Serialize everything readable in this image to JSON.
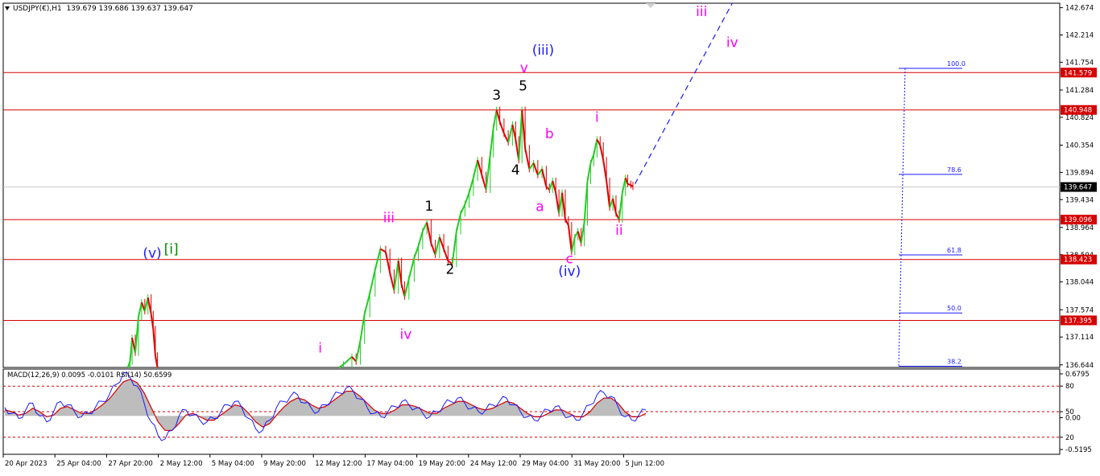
{
  "header": {
    "symbol": "USDJPY(€),H1",
    "ohlc": "139.679 139.686 139.637 139.647"
  },
  "indicator_header": "MACD(12,26,9) 0.0095 -0.0101  RSI(14) 50.6599",
  "colors": {
    "level_line": "#d50000",
    "wave_magenta": "#ff00ff",
    "wave_blue": "#1a1aff",
    "wave_green": "#008800",
    "bull_candle": "#22cc22",
    "bear_candle": "#e00000",
    "fib_blue": "#1a1aff",
    "current_price_bg": "#000000"
  },
  "chart_data": [
    {
      "type": "line",
      "name": "price",
      "ylim": [
        136.6,
        142.75
      ],
      "y_ticks": [
        "142.674",
        "142.214",
        "141.754",
        "141.284",
        "140.824",
        "140.354",
        "139.894",
        "139.434",
        "138.964",
        "138.504",
        "138.044",
        "137.574",
        "137.114",
        "136.644"
      ],
      "x_ticks": [
        "20 Apr 2023",
        "25 Apr 04:00",
        "27 Apr 20:00",
        "2 May 12:00",
        "5 May 04:00",
        "9 May 20:00",
        "12 May 12:00",
        "17 May 04:00",
        "19 May 20:00",
        "24 May 12:00",
        "29 May 04:00",
        "31 May 20:00",
        "5 Jun 12:00"
      ],
      "price_path": [
        [
          0.118,
          136.6
        ],
        [
          0.12,
          136.7
        ],
        [
          0.122,
          137.1
        ],
        [
          0.125,
          136.85
        ],
        [
          0.128,
          137.45
        ],
        [
          0.131,
          137.7
        ],
        [
          0.134,
          137.55
        ],
        [
          0.137,
          137.78
        ],
        [
          0.14,
          137.5
        ],
        [
          0.142,
          137.25
        ],
        [
          0.144,
          136.8
        ],
        [
          0.146,
          136.6
        ],
        [
          0.318,
          136.6
        ],
        [
          0.322,
          136.65
        ],
        [
          0.33,
          136.78
        ],
        [
          0.334,
          136.7
        ],
        [
          0.338,
          137.05
        ],
        [
          0.342,
          137.5
        ],
        [
          0.347,
          137.85
        ],
        [
          0.352,
          138.25
        ],
        [
          0.357,
          138.6
        ],
        [
          0.362,
          138.55
        ],
        [
          0.366,
          138.2
        ],
        [
          0.37,
          137.9
        ],
        [
          0.374,
          138.4
        ],
        [
          0.377,
          138.0
        ],
        [
          0.38,
          137.8
        ],
        [
          0.384,
          138.1
        ],
        [
          0.389,
          138.45
        ],
        [
          0.393,
          138.65
        ],
        [
          0.397,
          138.9
        ],
        [
          0.401,
          139.05
        ],
        [
          0.405,
          138.7
        ],
        [
          0.409,
          138.5
        ],
        [
          0.413,
          138.8
        ],
        [
          0.417,
          138.6
        ],
        [
          0.421,
          138.4
        ],
        [
          0.425,
          138.35
        ],
        [
          0.429,
          138.9
        ],
        [
          0.433,
          139.2
        ],
        [
          0.437,
          139.35
        ],
        [
          0.441,
          139.55
        ],
        [
          0.445,
          139.8
        ],
        [
          0.449,
          140.1
        ],
        [
          0.453,
          139.85
        ],
        [
          0.457,
          139.6
        ],
        [
          0.461,
          140.2
        ],
        [
          0.464,
          140.65
        ],
        [
          0.467,
          140.95
        ],
        [
          0.47,
          140.75
        ],
        [
          0.474,
          140.55
        ],
        [
          0.478,
          140.4
        ],
        [
          0.482,
          140.7
        ],
        [
          0.485,
          140.45
        ],
        [
          0.488,
          140.1
        ],
        [
          0.491,
          140.95
        ],
        [
          0.494,
          140.3
        ],
        [
          0.498,
          139.95
        ],
        [
          0.502,
          140.05
        ],
        [
          0.506,
          139.85
        ],
        [
          0.51,
          139.95
        ],
        [
          0.514,
          139.65
        ],
        [
          0.517,
          139.6
        ],
        [
          0.52,
          139.75
        ],
        [
          0.523,
          139.55
        ],
        [
          0.526,
          139.2
        ],
        [
          0.529,
          139.55
        ],
        [
          0.532,
          139.1
        ],
        [
          0.535,
          139.0
        ],
        [
          0.538,
          138.55
        ],
        [
          0.541,
          138.8
        ],
        [
          0.544,
          138.9
        ],
        [
          0.547,
          138.7
        ],
        [
          0.55,
          139.05
        ],
        [
          0.553,
          139.75
        ],
        [
          0.556,
          140.05
        ],
        [
          0.559,
          140.2
        ],
        [
          0.562,
          140.45
        ],
        [
          0.565,
          140.35
        ],
        [
          0.568,
          140.1
        ],
        [
          0.571,
          139.75
        ],
        [
          0.574,
          139.3
        ],
        [
          0.577,
          139.45
        ],
        [
          0.58,
          139.2
        ],
        [
          0.583,
          139.1
        ],
        [
          0.586,
          139.55
        ],
        [
          0.589,
          139.8
        ],
        [
          0.591,
          139.7
        ],
        [
          0.594,
          139.68
        ],
        [
          0.596,
          139.65
        ]
      ],
      "levels": [
        {
          "price": "141.579",
          "y": 141.579
        },
        {
          "price": "140.948",
          "y": 140.948
        },
        {
          "price": "139.096",
          "y": 139.096
        },
        {
          "price": "138.423",
          "y": 138.423
        },
        {
          "price": "137.395",
          "y": 137.395
        }
      ],
      "current_price": {
        "label": "139.647",
        "y": 139.647
      },
      "fib": [
        {
          "label": "100.0",
          "y": 141.65
        },
        {
          "label": "78.6",
          "y": 139.86
        },
        {
          "label": "61.8",
          "y": 138.5
        },
        {
          "label": "50.0",
          "y": 137.52
        },
        {
          "label": "38.2",
          "y": 136.62
        }
      ],
      "projection": [
        [
          0.598,
          139.7
        ],
        [
          0.69,
          142.75
        ]
      ],
      "wave_labels": [
        {
          "text": "(v)",
          "x": 0.141,
          "y": 138.45,
          "color": "blue"
        },
        {
          "text": "[i]",
          "x": 0.159,
          "y": 138.52,
          "color": "green"
        },
        {
          "text": "i",
          "x": 0.3,
          "y": 136.85,
          "color": "magenta"
        },
        {
          "text": "iii",
          "x": 0.365,
          "y": 139.05,
          "color": "magenta"
        },
        {
          "text": "iv",
          "x": 0.381,
          "y": 137.08,
          "color": "magenta"
        },
        {
          "text": "1",
          "x": 0.403,
          "y": 139.25,
          "color": "black"
        },
        {
          "text": "2",
          "x": 0.423,
          "y": 138.18,
          "color": "black"
        },
        {
          "text": "3",
          "x": 0.467,
          "y": 141.12,
          "color": "black"
        },
        {
          "text": "(iii)",
          "x": 0.511,
          "y": 141.88,
          "color": "blue"
        },
        {
          "text": "v",
          "x": 0.493,
          "y": 141.58,
          "color": "magenta"
        },
        {
          "text": "5",
          "x": 0.492,
          "y": 141.28,
          "color": "black"
        },
        {
          "text": "4",
          "x": 0.485,
          "y": 139.86,
          "color": "black"
        },
        {
          "text": "b",
          "x": 0.517,
          "y": 140.47,
          "color": "magenta"
        },
        {
          "text": "a",
          "x": 0.508,
          "y": 139.24,
          "color": "magenta"
        },
        {
          "text": "c",
          "x": 0.536,
          "y": 138.36,
          "color": "magenta"
        },
        {
          "text": "(iv)",
          "x": 0.536,
          "y": 138.15,
          "color": "blue"
        },
        {
          "text": "i",
          "x": 0.562,
          "y": 140.75,
          "color": "magenta"
        },
        {
          "text": "ii",
          "x": 0.583,
          "y": 138.84,
          "color": "magenta"
        },
        {
          "text": "iii",
          "x": 0.661,
          "y": 142.53,
          "color": "magenta"
        },
        {
          "text": "iv",
          "x": 0.69,
          "y": 142.01,
          "color": "magenta"
        }
      ]
    },
    {
      "type": "line",
      "name": "indicator",
      "y_ticks": [
        "0.6795",
        "80",
        "50",
        "0.00",
        "20",
        "-0.5195"
      ],
      "series": [
        {
          "values": [
            55,
            48,
            42,
            52,
            60,
            45,
            38,
            50,
            62,
            58,
            50,
            44,
            48,
            55,
            62,
            70,
            82,
            95,
            90,
            80,
            60,
            38,
            22,
            18,
            28,
            45,
            52,
            46,
            40,
            38,
            42,
            50,
            58,
            62,
            55,
            42,
            30,
            28,
            40,
            55,
            62,
            68,
            70,
            60,
            54,
            50,
            58,
            66,
            72,
            78,
            74,
            65,
            55,
            48,
            44,
            50,
            56,
            62,
            58,
            54,
            48,
            44,
            50,
            58,
            62,
            66,
            60,
            54,
            50,
            52,
            58,
            62,
            66,
            58,
            50,
            44,
            40,
            46,
            52,
            56,
            50,
            44,
            40,
            48,
            58,
            70,
            72,
            68,
            56,
            44,
            40,
            46,
            52
          ]
        },
        {
          "values": [
            52,
            50,
            46,
            48,
            54,
            50,
            44,
            46,
            54,
            56,
            52,
            48,
            48,
            52,
            58,
            65,
            75,
            85,
            88,
            84,
            72,
            55,
            38,
            28,
            28,
            36,
            46,
            48,
            44,
            40,
            40,
            46,
            52,
            58,
            56,
            48,
            38,
            32,
            36,
            46,
            55,
            62,
            66,
            64,
            58,
            54,
            56,
            62,
            68,
            74,
            74,
            68,
            60,
            52,
            48,
            48,
            52,
            58,
            58,
            56,
            52,
            48,
            48,
            54,
            58,
            62,
            62,
            58,
            54,
            52,
            54,
            58,
            62,
            60,
            54,
            48,
            44,
            44,
            48,
            52,
            52,
            48,
            44,
            44,
            50,
            60,
            66,
            66,
            60,
            50,
            44,
            44,
            48
          ]
        }
      ]
    }
  ]
}
